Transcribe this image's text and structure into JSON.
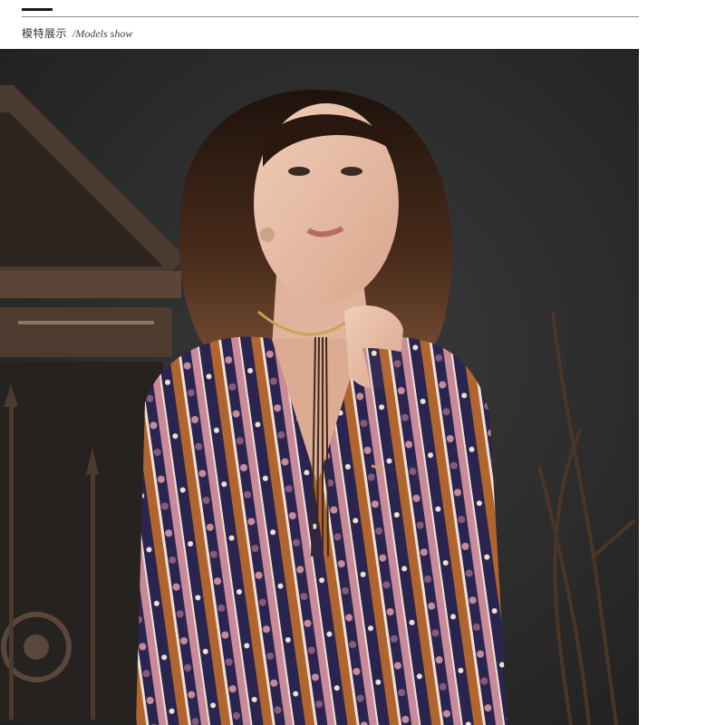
{
  "header": {
    "title_cn": "模特展示",
    "title_en": "/Models show"
  },
  "photo": {
    "subject": "model-photo",
    "colors": {
      "backdrop": "#2b2b2b",
      "dress_navy": "#2a2550",
      "dress_rust": "#b0652e",
      "dress_pink": "#c98a9a",
      "skin": "#e9c3ad",
      "hair": "#3a2418"
    }
  }
}
